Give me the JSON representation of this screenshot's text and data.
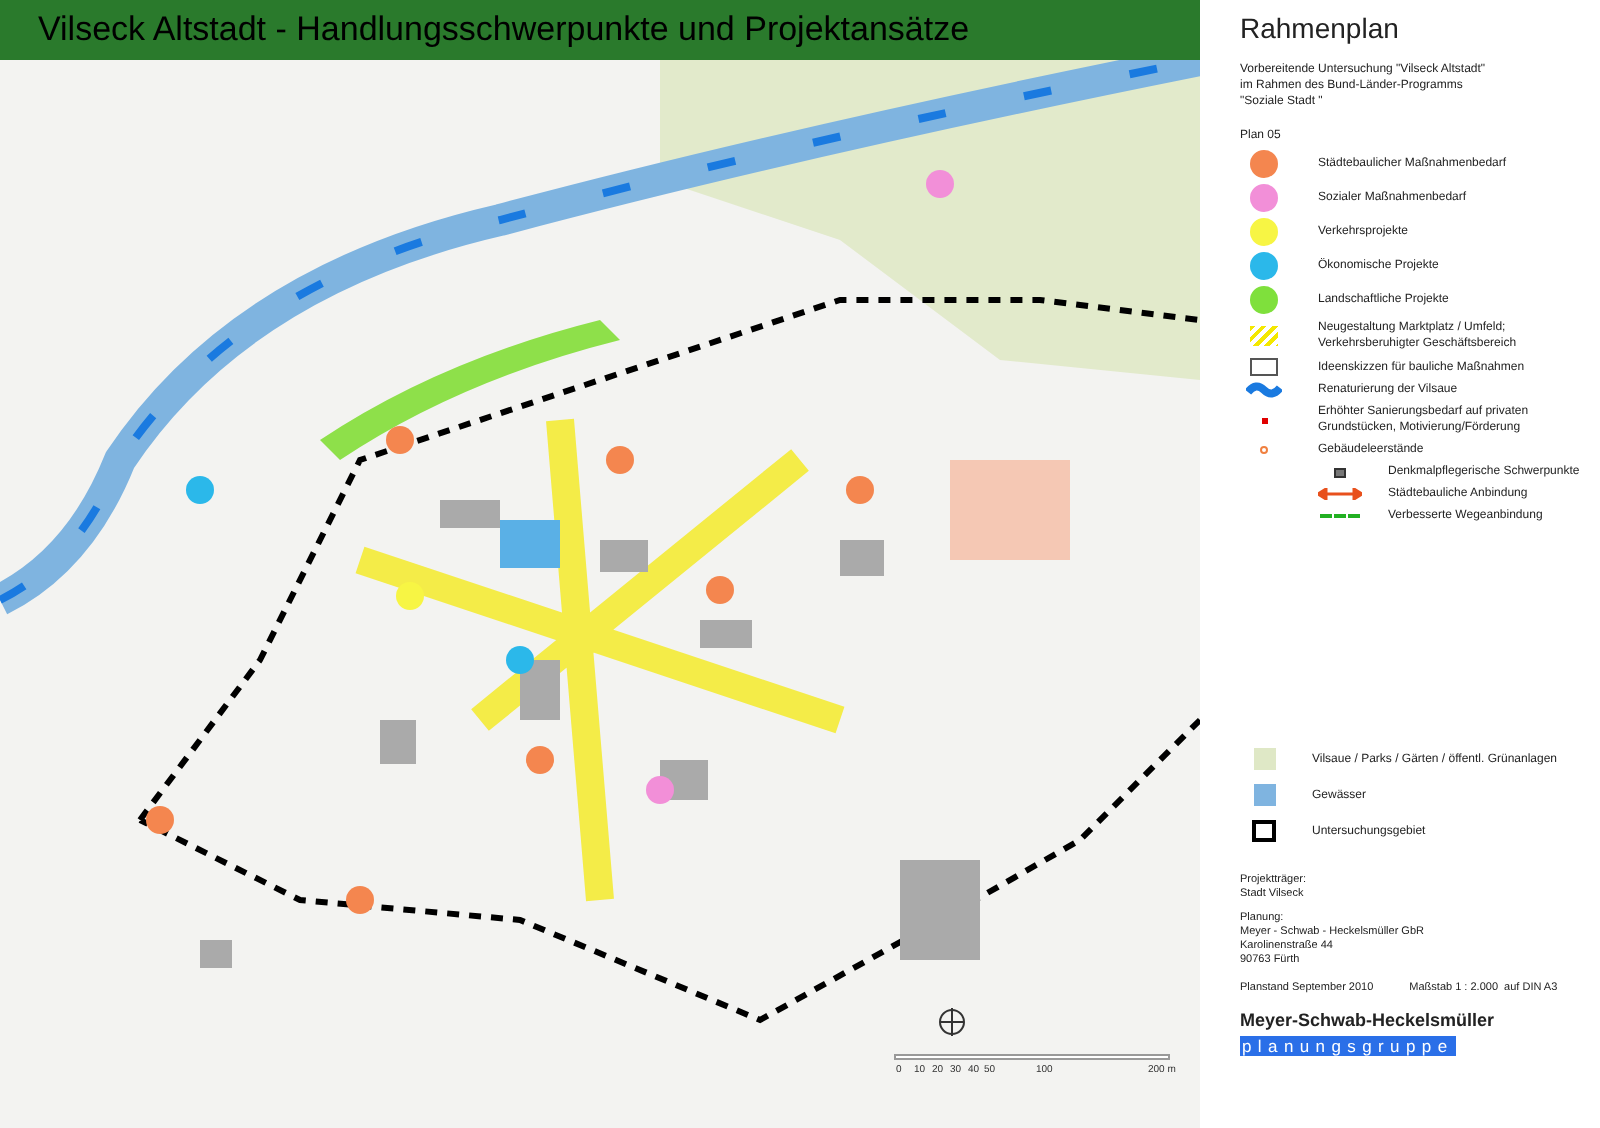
{
  "title": "Vilseck Altstadt - Handlungsschwerpunkte und Projektansätze",
  "scale_bar": {
    "labels": [
      "0",
      "10",
      "20",
      "30",
      "40",
      "50",
      "100",
      "200 m"
    ]
  },
  "panel": {
    "title": "Rahmenplan",
    "subtitle": [
      "Vorbereitende Untersuchung \"Vilseck Altstadt\"",
      "im Rahmen des Bund-Länder-Programms",
      "\"Soziale Stadt \""
    ],
    "plan": "Plan 05",
    "legend": [
      {
        "kind": "circle",
        "color": "#f4864f",
        "label": "Städtebaulicher Maßnahmenbedarf"
      },
      {
        "kind": "circle",
        "color": "#f28fd8",
        "label": "Sozialer Maßnahmenbedarf"
      },
      {
        "kind": "circle",
        "color": "#f7f544",
        "label": "Verkehrsprojekte"
      },
      {
        "kind": "circle",
        "color": "#2bb8ea",
        "label": "Ökonomische Projekte"
      },
      {
        "kind": "circle",
        "color": "#7fe03c",
        "label": "Landschaftliche Projekte"
      },
      {
        "kind": "hatch",
        "label": "Neugestaltung Marktplatz / Umfeld; Verkehrsberuhigter Geschäftsbereich"
      },
      {
        "kind": "outline",
        "label": "Ideenskizzen für bauliche Maßnahmen"
      },
      {
        "kind": "wave",
        "label": "Renaturierung der Vilsaue"
      },
      {
        "kind": "dot",
        "label": "Erhöhter Sanierungsbedarf auf privaten Grundstücken, Motivierung/Förderung"
      },
      {
        "kind": "ring",
        "label": "Gebäudeleerstände"
      },
      {
        "kind": "monument",
        "label": "Denkmalpflegerische Schwerpunkte"
      },
      {
        "kind": "arrow",
        "label": "Städtebauliche Anbindung"
      },
      {
        "kind": "dashed",
        "label": "Verbesserte Wegeanbindung"
      }
    ],
    "areas": [
      {
        "kind": "fill",
        "color": "#dfe8c6",
        "label": "Vilsaue / Parks / Gärten / öffentl. Grünanlagen"
      },
      {
        "kind": "fill",
        "color": "#7fb4e0",
        "label": "Gewässer"
      },
      {
        "kind": "dashedbox",
        "label": "Untersuchungsgebiet"
      }
    ],
    "sponsor": [
      "Projektträger:",
      "Stadt Vilseck"
    ],
    "planner": [
      "Planung:",
      "Meyer - Schwab - Heckelsmüller GbR",
      "Karolinenstraße 44",
      "90763 Fürth"
    ],
    "date": "Planstand September 2010",
    "scale": "Maßstab 1 : 2.000  auf DIN A3",
    "logo": {
      "name": "Meyer-Schwab-Heckelsmüller",
      "group": "planungsgruppe"
    }
  }
}
